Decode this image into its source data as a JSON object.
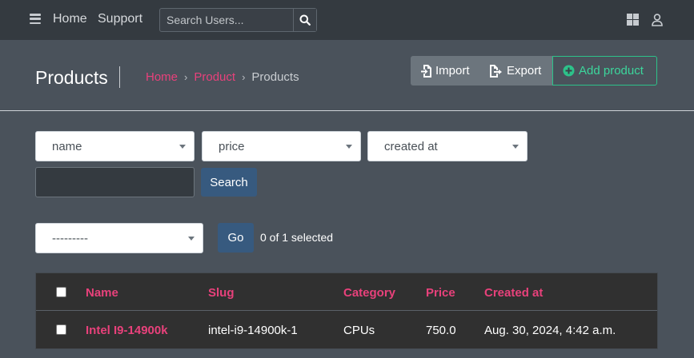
{
  "navbar": {
    "home_label": "Home",
    "support_label": "Support",
    "search_placeholder": "Search Users..."
  },
  "header": {
    "title": "Products",
    "breadcrumb": [
      "Home",
      "Product",
      "Products"
    ],
    "separator": "›",
    "import_label": "Import",
    "export_label": "Export",
    "add_label": "Add product"
  },
  "filters": {
    "select_name": "name",
    "select_price": "price",
    "select_created": "created at",
    "search_value": "",
    "search_label": "Search"
  },
  "actions": {
    "action_select": "---------",
    "go_label": "Go",
    "selected_text": "0 of 1 selected"
  },
  "table": {
    "headers": [
      "Name",
      "Slug",
      "Category",
      "Price",
      "Created at"
    ],
    "rows": [
      [
        "Intel I9-14900k",
        "intel-i9-14900k-1",
        "CPUs",
        "750.0",
        "Aug. 30, 2024, 4:42 a.m."
      ]
    ]
  },
  "colors": {
    "accent_pink": "#e8417b",
    "accent_green": "#2dc28a",
    "primary_blue": "#375a7f",
    "navbar_bg": "#343a40",
    "page_bg": "#4a525b"
  },
  "icons": [
    "hamburger-icon",
    "search-icon",
    "grid-icon",
    "user-icon",
    "file-import-icon",
    "file-export-icon",
    "plus-circle-icon",
    "chevron-down-icon"
  ]
}
